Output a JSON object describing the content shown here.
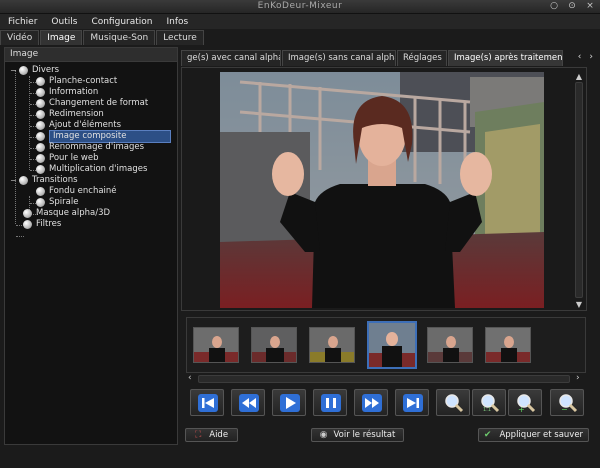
{
  "window": {
    "title": "EnKoDeur-Mixeur"
  },
  "menu": [
    "Fichier",
    "Outils",
    "Configuration",
    "Infos"
  ],
  "main_tabs": [
    "Vidéo",
    "Image",
    "Musique-Son",
    "Lecture"
  ],
  "left_panel": {
    "header": "Image",
    "tree": [
      {
        "label": "Divers"
      },
      {
        "label": "Planche-contact"
      },
      {
        "label": "Information"
      },
      {
        "label": "Changement de format"
      },
      {
        "label": "Redimension"
      },
      {
        "label": "Ajout d'éléments"
      },
      {
        "label": "Image composite"
      },
      {
        "label": "Renommage d'images"
      },
      {
        "label": "Pour le web"
      },
      {
        "label": "Multiplication d'images"
      },
      {
        "label": "Transitions"
      },
      {
        "label": "Fondu enchainé"
      },
      {
        "label": "Spirale"
      },
      {
        "label": "Masque alpha/3D"
      },
      {
        "label": "Filtres"
      }
    ]
  },
  "right_tabs": [
    "ge(s) avec canal alpha",
    "Image(s) sans canal alpha",
    "Réglages",
    "Image(s) après traitement"
  ],
  "icons": {
    "close": "×",
    "scroll_up": "▲",
    "scroll_down": "▼",
    "left": "‹",
    "right": "›",
    "expand": "−",
    "aide": "⛶",
    "eye": "◉",
    "check": "✔"
  },
  "buttons": {
    "aide": "Aide",
    "voir": "Voir le résultat",
    "appliquer": "Appliquer et sauver"
  },
  "colors": {
    "accent": "#2c4f86",
    "selection_border": "#3d6fb8",
    "transport_icon": "#3f7fe0"
  }
}
